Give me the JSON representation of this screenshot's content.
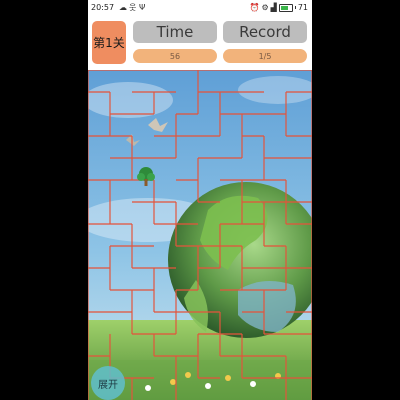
{
  "status_bar": {
    "time": "20:57",
    "battery_text": "71",
    "battery_level": 0.71,
    "icons": [
      "cloud-icon",
      "person-icon",
      "usb-icon",
      "alarm-icon",
      "settings-icon",
      "signal-icon",
      "battery-icon"
    ]
  },
  "header": {
    "level_label": "第1关",
    "time_button_label": "Time",
    "record_button_label": "Record",
    "time_value": "56",
    "record_value": "1/5"
  },
  "game": {
    "expand_button_label": "展开",
    "player_icon": "tree-icon",
    "maze_line_color": "#e4553c",
    "background_theme": "green-globe-meadow"
  },
  "colors": {
    "accent": "#ef8d60",
    "value_pill": "#f2b37b",
    "button_gray": "#bdbdbd"
  }
}
